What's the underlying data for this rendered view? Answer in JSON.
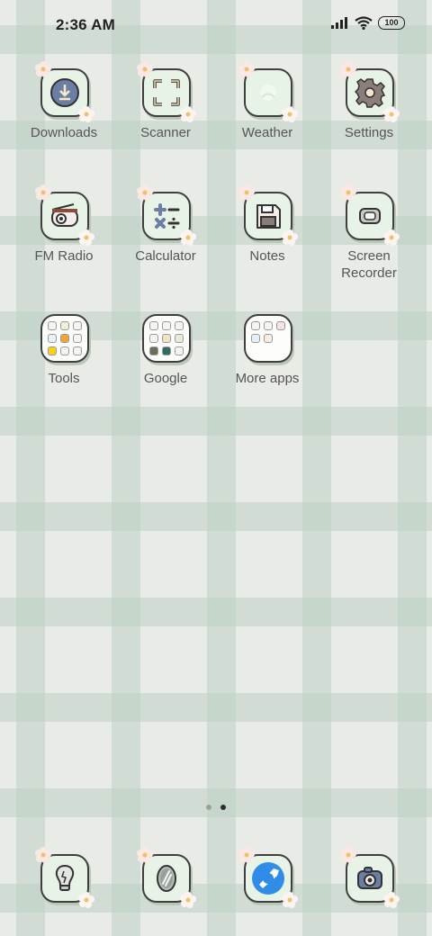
{
  "status_bar": {
    "time": "2:36 AM",
    "battery": "100"
  },
  "apps": {
    "downloads": "Downloads",
    "scanner": "Scanner",
    "weather": "Weather",
    "settings": "Settings",
    "fm_radio": "FM Radio",
    "calculator": "Calculator",
    "notes": "Notes",
    "screen_recorder": "Screen Recorder",
    "tools": "Tools",
    "google": "Google",
    "more_apps": "More apps"
  },
  "dock": [
    {
      "name": "flashlight-app",
      "icon": "lightbulb-icon"
    },
    {
      "name": "mirror-app",
      "icon": "mirror-icon"
    },
    {
      "name": "browser-app",
      "icon": "browser-icon"
    },
    {
      "name": "camera-app",
      "icon": "camera-icon"
    }
  ],
  "pages": {
    "count": 2,
    "active": 2
  },
  "colors": {
    "tile": "#e7f3e6",
    "outline": "#3f3f3f",
    "accent_blue": "#2f8de8"
  }
}
